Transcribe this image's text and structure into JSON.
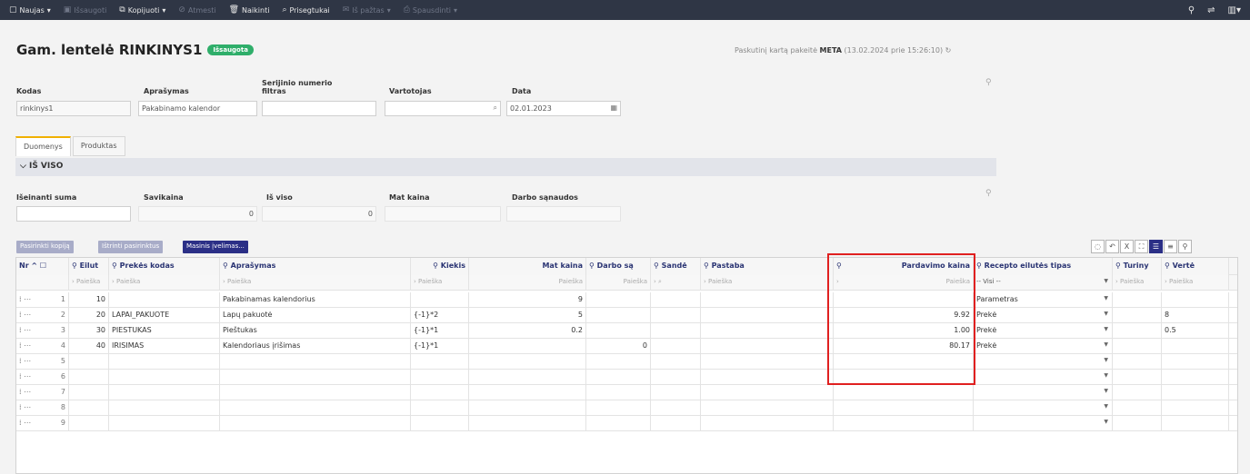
{
  "toolbar": {
    "items": [
      {
        "label": "Naujas",
        "icon": "new-doc-icon",
        "disabled": false,
        "arrow": true
      },
      {
        "label": "Išsaugoti",
        "icon": "save-icon",
        "disabled": true,
        "arrow": false
      },
      {
        "label": "Kopijuoti",
        "icon": "copy-icon",
        "disabled": false,
        "arrow": true
      },
      {
        "label": "Atmesti",
        "icon": "discard-icon",
        "disabled": true,
        "arrow": false
      },
      {
        "label": "Naikinti",
        "icon": "trash-icon",
        "disabled": false,
        "arrow": false
      },
      {
        "label": "Prisegtukai",
        "icon": "paperclip-icon",
        "disabled": false,
        "arrow": false
      },
      {
        "label": "Iš pažtas",
        "icon": "mail-icon",
        "disabled": true,
        "arrow": true
      },
      {
        "label": "Spausdinti",
        "icon": "print-icon",
        "disabled": true,
        "arrow": true
      }
    ],
    "right_icons": [
      "pin-icon",
      "settings-icon",
      "layout-icon"
    ]
  },
  "header": {
    "title": "Gam. lentelė RINKINYS1",
    "badge": "Išsaugota",
    "last_changed_prefix": "Paskutinį kartą pakeitė",
    "last_changed_user": "META",
    "last_changed_time": "(13.02.2024 prie 15:26:10)"
  },
  "form": {
    "kodas_label": "Kodas",
    "kodas_value": "rinkinys1",
    "aprasymas_label": "Aprašymas",
    "aprasymas_value": "Pakabinamo kalendor",
    "serijinio_label_1": "Serijinio numerio",
    "serijinio_label_2": "filtras",
    "serijinio_value": "",
    "vartotojas_label": "Vartotojas",
    "vartotojas_value": "",
    "data_label": "Data",
    "data_value": "02.01.2023"
  },
  "tabs": [
    {
      "label": "Duomenys",
      "active": true
    },
    {
      "label": "Produktas",
      "active": false
    }
  ],
  "section": {
    "title": "IŠ VISO"
  },
  "totals": {
    "iseinanti_label": "Išeinanti suma",
    "iseinanti_value": "",
    "savikaina_label": "Savikaina",
    "savikaina_value": "0",
    "is_viso_label": "Iš viso",
    "is_viso_value": "0",
    "mat_kaina_label": "Mat kaina",
    "mat_kaina_value": "",
    "darbo_label": "Darbo sąnaudos",
    "darbo_value": ""
  },
  "grid_buttons": {
    "btn1": "Pasirinkti kopiją",
    "btn2": "Ištrinti pasirinktus",
    "btn3": "Masinis įvelimas..."
  },
  "columns": {
    "nr": "Nr",
    "eilut": "Eilut",
    "prekes_kodas": "Prekės kodas",
    "aprasymas": "Aprašymas",
    "kiekis": "Kiekis",
    "mat_kaina": "Mat kaina",
    "darbo": "Darbo są",
    "sande": "Sandė",
    "pastaba": "Pastaba",
    "pardavimo": "Pardavimo kaina",
    "recepto": "Recepto eilutės tipas",
    "turiny": "Turiny",
    "verte": "Vertė"
  },
  "filters": {
    "paieska": "Paieška",
    "visi": "-- Visi --"
  },
  "rows": [
    {
      "nr": "1",
      "eilut": "10",
      "kodas": "",
      "aprasymas": "Pakabinamas kalendorius",
      "kiekis": "",
      "mat": "9",
      "darbo": "",
      "sande": "",
      "pastaba": "",
      "pardavimo": "",
      "tipas": "Parametras",
      "turiny": "",
      "verte": ""
    },
    {
      "nr": "2",
      "eilut": "20",
      "kodas": "LAPAI_PAKUOTE",
      "aprasymas": "Lapų pakuotė",
      "kiekis": "{-1}*2",
      "mat": "5",
      "darbo": "",
      "sande": "",
      "pastaba": "",
      "pardavimo": "9.92",
      "tipas": "Prekė",
      "turiny": "",
      "verte": "8"
    },
    {
      "nr": "3",
      "eilut": "30",
      "kodas": "PIESTUKAS",
      "aprasymas": "Pieštukas",
      "kiekis": "{-1}*1",
      "mat": "0.2",
      "darbo": "",
      "sande": "",
      "pastaba": "",
      "pardavimo": "1.00",
      "tipas": "Prekė",
      "turiny": "",
      "verte": "0.5"
    },
    {
      "nr": "4",
      "eilut": "40",
      "kodas": "IRISIMAS",
      "aprasymas": "Kalendoriaus įrišimas",
      "kiekis": "{-1}*1",
      "mat": "",
      "darbo": "0",
      "sande": "",
      "pastaba": "",
      "pardavimo": "80.17",
      "tipas": "Prekė",
      "turiny": "",
      "verte": ""
    },
    {
      "nr": "5",
      "eilut": "",
      "kodas": "",
      "aprasymas": "",
      "kiekis": "",
      "mat": "",
      "darbo": "",
      "sande": "",
      "pastaba": "",
      "pardavimo": "",
      "tipas": "",
      "turiny": "",
      "verte": ""
    },
    {
      "nr": "6",
      "eilut": "",
      "kodas": "",
      "aprasymas": "",
      "kiekis": "",
      "mat": "",
      "darbo": "",
      "sande": "",
      "pastaba": "",
      "pardavimo": "",
      "tipas": "",
      "turiny": "",
      "verte": ""
    },
    {
      "nr": "7",
      "eilut": "",
      "kodas": "",
      "aprasymas": "",
      "kiekis": "",
      "mat": "",
      "darbo": "",
      "sande": "",
      "pastaba": "",
      "pardavimo": "",
      "tipas": "",
      "turiny": "",
      "verte": ""
    },
    {
      "nr": "8",
      "eilut": "",
      "kodas": "",
      "aprasymas": "",
      "kiekis": "",
      "mat": "",
      "darbo": "",
      "sande": "",
      "pastaba": "",
      "pardavimo": "",
      "tipas": "",
      "turiny": "",
      "verte": ""
    },
    {
      "nr": "9",
      "eilut": "",
      "kodas": "",
      "aprasymas": "",
      "kiekis": "",
      "mat": "",
      "darbo": "",
      "sande": "",
      "pastaba": "",
      "pardavimo": "",
      "tipas": "",
      "turiny": "",
      "verte": ""
    }
  ],
  "colors": {
    "topbar": "#2f3645",
    "badge": "#2fae6a",
    "accent": "#2b2f86",
    "highlight": "#e02020"
  }
}
